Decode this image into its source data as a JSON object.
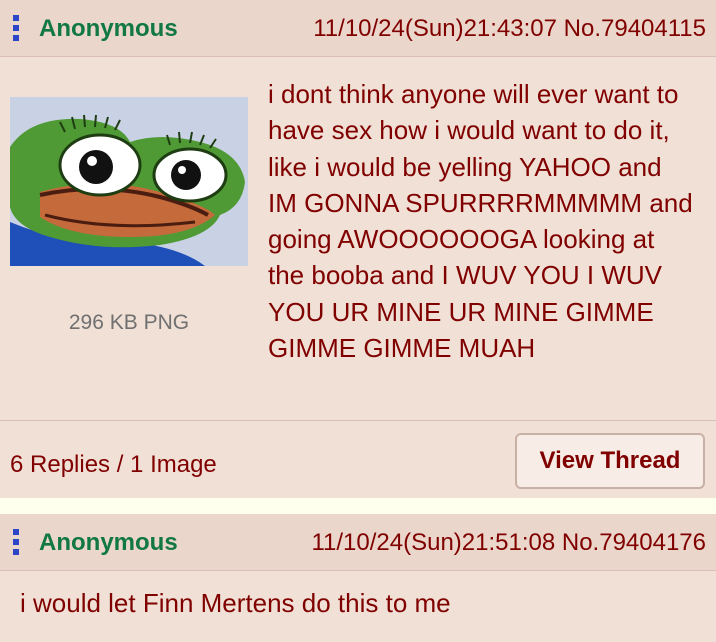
{
  "colors": {
    "post_bg": "#f0e0d6",
    "header_bg": "#ead6ca",
    "page_bg": "#ffffee",
    "text": "#800000",
    "name": "#117743",
    "menu_dots": "#2d45c7",
    "fileinfo": "#707070"
  },
  "posts": [
    {
      "menu_icon": "vertical-dots-icon",
      "name": "Anonymous",
      "datetime_no": "11/10/24(Sun)21:43:07 No.79404115",
      "thumbnail": "pepe-frog-crying-thumbnail",
      "file_info": "296 KB PNG",
      "comment": "i dont think anyone will ever want to have sex how i would want to do it, like i would be yelling YAHOO and IM GONNA SPURRRRMMMMM and going AWOOOOOOGA looking at the booba and I WUV YOU I WUV YOU UR MINE UR MINE GIMME GIMME GIMME MUAH",
      "replies_summary": "6 Replies / 1 Image",
      "view_thread_label": "View Thread"
    },
    {
      "menu_icon": "vertical-dots-icon",
      "name": "Anonymous",
      "datetime_no": "11/10/24(Sun)21:51:08 No.79404176",
      "comment": "i would let Finn Mertens do this to me"
    }
  ]
}
